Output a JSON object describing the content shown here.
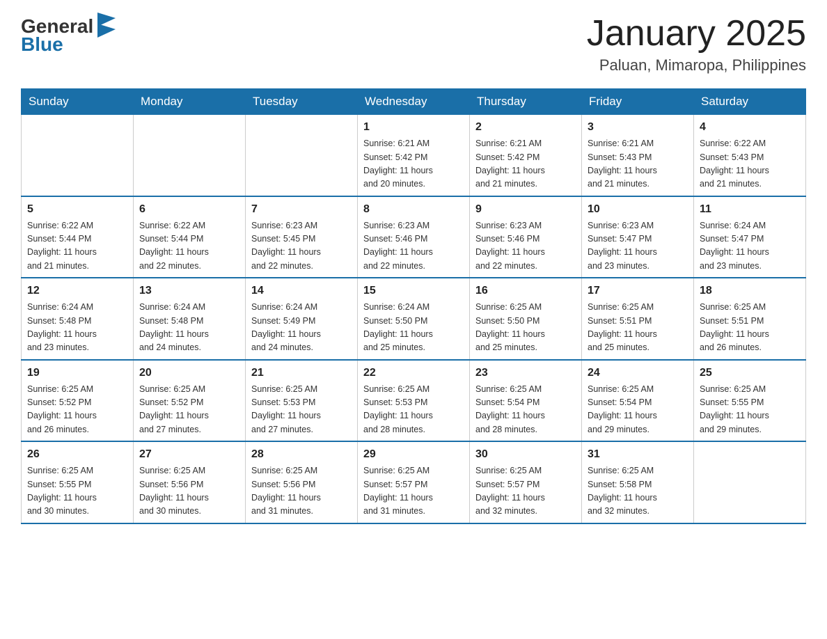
{
  "header": {
    "logo_general": "General",
    "logo_blue": "Blue",
    "month_title": "January 2025",
    "location": "Paluan, Mimaropa, Philippines"
  },
  "days_of_week": [
    "Sunday",
    "Monday",
    "Tuesday",
    "Wednesday",
    "Thursday",
    "Friday",
    "Saturday"
  ],
  "weeks": [
    [
      {
        "day": "",
        "info": ""
      },
      {
        "day": "",
        "info": ""
      },
      {
        "day": "",
        "info": ""
      },
      {
        "day": "1",
        "info": "Sunrise: 6:21 AM\nSunset: 5:42 PM\nDaylight: 11 hours\nand 20 minutes."
      },
      {
        "day": "2",
        "info": "Sunrise: 6:21 AM\nSunset: 5:42 PM\nDaylight: 11 hours\nand 21 minutes."
      },
      {
        "day": "3",
        "info": "Sunrise: 6:21 AM\nSunset: 5:43 PM\nDaylight: 11 hours\nand 21 minutes."
      },
      {
        "day": "4",
        "info": "Sunrise: 6:22 AM\nSunset: 5:43 PM\nDaylight: 11 hours\nand 21 minutes."
      }
    ],
    [
      {
        "day": "5",
        "info": "Sunrise: 6:22 AM\nSunset: 5:44 PM\nDaylight: 11 hours\nand 21 minutes."
      },
      {
        "day": "6",
        "info": "Sunrise: 6:22 AM\nSunset: 5:44 PM\nDaylight: 11 hours\nand 22 minutes."
      },
      {
        "day": "7",
        "info": "Sunrise: 6:23 AM\nSunset: 5:45 PM\nDaylight: 11 hours\nand 22 minutes."
      },
      {
        "day": "8",
        "info": "Sunrise: 6:23 AM\nSunset: 5:46 PM\nDaylight: 11 hours\nand 22 minutes."
      },
      {
        "day": "9",
        "info": "Sunrise: 6:23 AM\nSunset: 5:46 PM\nDaylight: 11 hours\nand 22 minutes."
      },
      {
        "day": "10",
        "info": "Sunrise: 6:23 AM\nSunset: 5:47 PM\nDaylight: 11 hours\nand 23 minutes."
      },
      {
        "day": "11",
        "info": "Sunrise: 6:24 AM\nSunset: 5:47 PM\nDaylight: 11 hours\nand 23 minutes."
      }
    ],
    [
      {
        "day": "12",
        "info": "Sunrise: 6:24 AM\nSunset: 5:48 PM\nDaylight: 11 hours\nand 23 minutes."
      },
      {
        "day": "13",
        "info": "Sunrise: 6:24 AM\nSunset: 5:48 PM\nDaylight: 11 hours\nand 24 minutes."
      },
      {
        "day": "14",
        "info": "Sunrise: 6:24 AM\nSunset: 5:49 PM\nDaylight: 11 hours\nand 24 minutes."
      },
      {
        "day": "15",
        "info": "Sunrise: 6:24 AM\nSunset: 5:50 PM\nDaylight: 11 hours\nand 25 minutes."
      },
      {
        "day": "16",
        "info": "Sunrise: 6:25 AM\nSunset: 5:50 PM\nDaylight: 11 hours\nand 25 minutes."
      },
      {
        "day": "17",
        "info": "Sunrise: 6:25 AM\nSunset: 5:51 PM\nDaylight: 11 hours\nand 25 minutes."
      },
      {
        "day": "18",
        "info": "Sunrise: 6:25 AM\nSunset: 5:51 PM\nDaylight: 11 hours\nand 26 minutes."
      }
    ],
    [
      {
        "day": "19",
        "info": "Sunrise: 6:25 AM\nSunset: 5:52 PM\nDaylight: 11 hours\nand 26 minutes."
      },
      {
        "day": "20",
        "info": "Sunrise: 6:25 AM\nSunset: 5:52 PM\nDaylight: 11 hours\nand 27 minutes."
      },
      {
        "day": "21",
        "info": "Sunrise: 6:25 AM\nSunset: 5:53 PM\nDaylight: 11 hours\nand 27 minutes."
      },
      {
        "day": "22",
        "info": "Sunrise: 6:25 AM\nSunset: 5:53 PM\nDaylight: 11 hours\nand 28 minutes."
      },
      {
        "day": "23",
        "info": "Sunrise: 6:25 AM\nSunset: 5:54 PM\nDaylight: 11 hours\nand 28 minutes."
      },
      {
        "day": "24",
        "info": "Sunrise: 6:25 AM\nSunset: 5:54 PM\nDaylight: 11 hours\nand 29 minutes."
      },
      {
        "day": "25",
        "info": "Sunrise: 6:25 AM\nSunset: 5:55 PM\nDaylight: 11 hours\nand 29 minutes."
      }
    ],
    [
      {
        "day": "26",
        "info": "Sunrise: 6:25 AM\nSunset: 5:55 PM\nDaylight: 11 hours\nand 30 minutes."
      },
      {
        "day": "27",
        "info": "Sunrise: 6:25 AM\nSunset: 5:56 PM\nDaylight: 11 hours\nand 30 minutes."
      },
      {
        "day": "28",
        "info": "Sunrise: 6:25 AM\nSunset: 5:56 PM\nDaylight: 11 hours\nand 31 minutes."
      },
      {
        "day": "29",
        "info": "Sunrise: 6:25 AM\nSunset: 5:57 PM\nDaylight: 11 hours\nand 31 minutes."
      },
      {
        "day": "30",
        "info": "Sunrise: 6:25 AM\nSunset: 5:57 PM\nDaylight: 11 hours\nand 32 minutes."
      },
      {
        "day": "31",
        "info": "Sunrise: 6:25 AM\nSunset: 5:58 PM\nDaylight: 11 hours\nand 32 minutes."
      },
      {
        "day": "",
        "info": ""
      }
    ]
  ]
}
